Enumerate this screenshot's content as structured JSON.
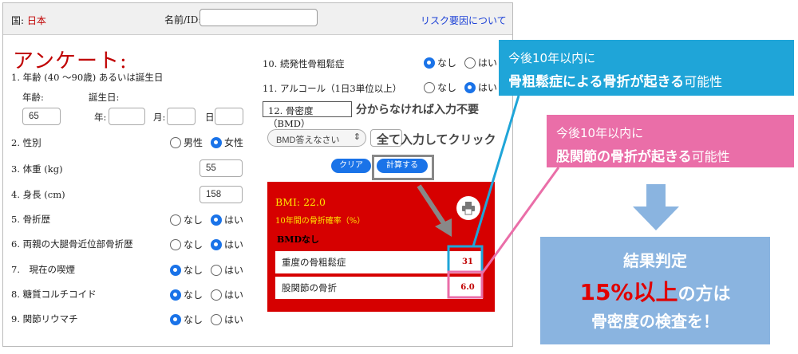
{
  "topbar": {
    "country_label": "国: ",
    "country_value": "日本",
    "name_label": "名前/ID:",
    "risk_link": "リスク要因について"
  },
  "form_title": "アンケート:",
  "q1": {
    "label": "1. 年齢 (40 〜90歳) あるいは誕生日",
    "age_label": "年齢:",
    "birth_label": "誕生日:",
    "age_value": "65",
    "year_label": "年:",
    "month_label": "月:",
    "day_label": "日:"
  },
  "q2": {
    "label": "2. 性別",
    "opt1": "男性",
    "opt2": "女性"
  },
  "q3": {
    "label": "3. 体重 (kg)",
    "value": "55"
  },
  "q4": {
    "label": "4. 身長 (cm)",
    "value": "158"
  },
  "q5": {
    "label": "5. 骨折歴",
    "opt1": "なし",
    "opt2": "はい"
  },
  "q6": {
    "label": "6. 両親の大腿骨近位部骨折歴",
    "opt1": "なし",
    "opt2": "はい"
  },
  "q7": {
    "label": "7.　現在の喫煙",
    "opt1": "なし",
    "opt2": "はい"
  },
  "q8": {
    "label": "8. 糖質コルチコイド",
    "opt1": "なし",
    "opt2": "はい"
  },
  "q9": {
    "label": "9. 関節リウマチ",
    "opt1": "なし",
    "opt2": "はい"
  },
  "q10": {
    "label": "10. 続発性骨粗鬆症",
    "opt1": "なし",
    "opt2": "はい"
  },
  "q11": {
    "label": "11. アルコール（1日3単位以上）",
    "opt1": "なし",
    "opt2": "はい"
  },
  "q12": {
    "label": "12. 骨密度（BMD）",
    "note": "分からなければ入力不要",
    "select_placeholder": "BMD答えなさい"
  },
  "click_note": "全て入力してクリック",
  "buttons": {
    "clear": "クリア",
    "calculate": "計算する"
  },
  "result": {
    "bmi": "BMI: 22.0",
    "prob_label": "10年間の骨折確率（%）",
    "bmd_none": "BMDなし",
    "major_label": "重度の骨粗鬆症",
    "major_value": "31",
    "hip_label": "股関節の骨折",
    "hip_value": "6.0"
  },
  "callout_blue": {
    "line1": "今後10年以内に",
    "line2_bold": "骨粗鬆症による骨折が起きる",
    "line2_rest": "可能性"
  },
  "callout_pink": {
    "line1": "今後10年以内に",
    "line2_bold": "股関節の骨折が起きる",
    "line2_rest": "可能性"
  },
  "judgement": {
    "title": "結果判定",
    "red": "15%以上",
    "mid_rest": "の方は",
    "bottom": "骨密度の検査を！"
  },
  "colors": {
    "accent_blue": "#1a73e8",
    "result_red": "#d60000",
    "callout_blue": "#1fa5d8",
    "callout_pink": "#ea6ea8",
    "judgement_bg": "#8ab4e0"
  }
}
